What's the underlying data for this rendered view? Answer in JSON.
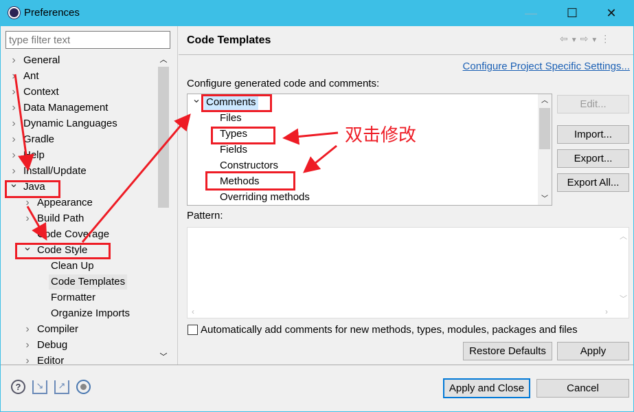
{
  "window": {
    "title": "Preferences",
    "minimize": "—",
    "maximize": "☐",
    "close": "✕"
  },
  "sidebar": {
    "filter_placeholder": "type filter text",
    "items": [
      {
        "label": "General",
        "level": 0,
        "state": "collapsed"
      },
      {
        "label": "Ant",
        "level": 0,
        "state": "collapsed"
      },
      {
        "label": "Context",
        "level": 0,
        "state": "collapsed"
      },
      {
        "label": "Data Management",
        "level": 0,
        "state": "collapsed"
      },
      {
        "label": "Dynamic Languages",
        "level": 0,
        "state": "collapsed"
      },
      {
        "label": "Gradle",
        "level": 0,
        "state": "collapsed"
      },
      {
        "label": "Help",
        "level": 0,
        "state": "collapsed"
      },
      {
        "label": "Install/Update",
        "level": 0,
        "state": "collapsed"
      },
      {
        "label": "Java",
        "level": 0,
        "state": "expanded"
      },
      {
        "label": "Appearance",
        "level": 1,
        "state": "collapsed"
      },
      {
        "label": "Build Path",
        "level": 1,
        "state": "collapsed"
      },
      {
        "label": "Code Coverage",
        "level": 1,
        "state": "leaf"
      },
      {
        "label": "Code Style",
        "level": 1,
        "state": "expanded"
      },
      {
        "label": "Clean Up",
        "level": 2,
        "state": "leaf"
      },
      {
        "label": "Code Templates",
        "level": 2,
        "state": "leaf",
        "selected": true
      },
      {
        "label": "Formatter",
        "level": 2,
        "state": "leaf"
      },
      {
        "label": "Organize Imports",
        "level": 2,
        "state": "leaf"
      },
      {
        "label": "Compiler",
        "level": 1,
        "state": "collapsed"
      },
      {
        "label": "Debug",
        "level": 1,
        "state": "collapsed"
      },
      {
        "label": "Editor",
        "level": 1,
        "state": "collapsed"
      }
    ]
  },
  "main": {
    "title": "Code Templates",
    "nav_icons": [
      "back-arrow-icon",
      "dropdown-icon",
      "forward-arrow-icon",
      "dropdown-icon",
      "more-icon"
    ],
    "project_link": "Configure Project Specific Settings...",
    "configure_label": "Configure generated code and comments:",
    "templates": [
      {
        "label": "Comments",
        "level": 0,
        "state": "expanded",
        "selected": true
      },
      {
        "label": "Files",
        "level": 1
      },
      {
        "label": "Types",
        "level": 1
      },
      {
        "label": "Fields",
        "level": 1
      },
      {
        "label": "Constructors",
        "level": 1
      },
      {
        "label": "Methods",
        "level": 1
      },
      {
        "label": "Overriding methods",
        "level": 1
      }
    ],
    "buttons": {
      "edit": "Edit...",
      "import": "Import...",
      "export": "Export...",
      "export_all": "Export All..."
    },
    "pattern_label": "Pattern:",
    "pattern_value": "",
    "auto_comments_label": "Automatically add comments for new methods, types, modules, packages and files",
    "auto_comments_checked": false,
    "restore_defaults": "Restore Defaults",
    "apply": "Apply"
  },
  "footer": {
    "icons": [
      "help-icon",
      "import-icon",
      "export-icon",
      "record-icon"
    ],
    "apply_close": "Apply and Close",
    "cancel": "Cancel"
  },
  "annotation": {
    "text": "双击修改",
    "color": "#ee1c25"
  }
}
